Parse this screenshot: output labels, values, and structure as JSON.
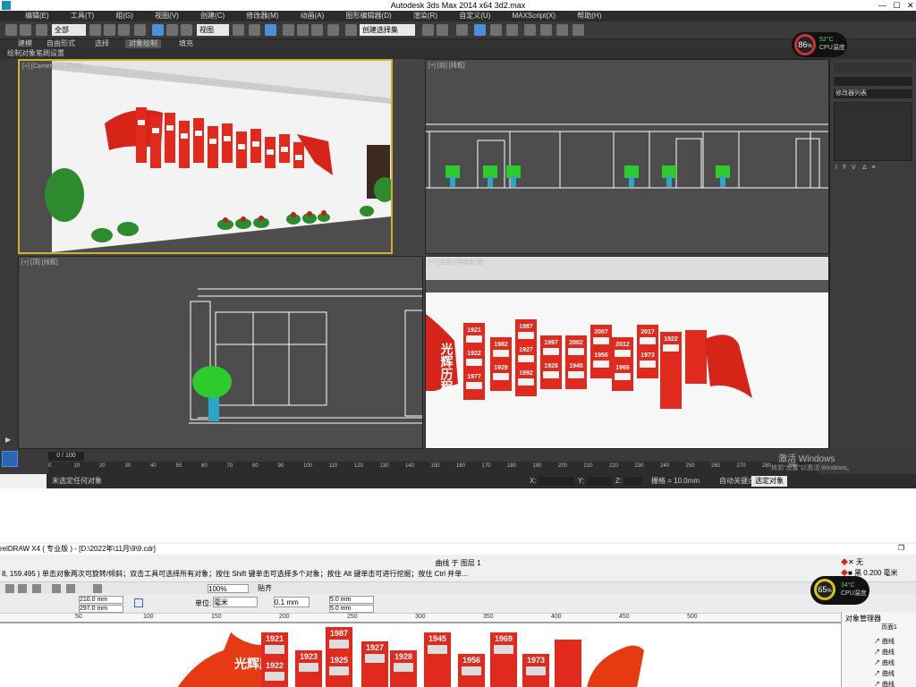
{
  "max_window": {
    "title": "Autodesk 3ds Max  2014 x64      3d2.max",
    "menus": [
      "编辑(E)",
      "工具(T)",
      "组(G)",
      "视图(V)",
      "创建(C)",
      "修改器(M)",
      "动画(A)",
      "图形编辑器(D)",
      "渲染(R)",
      "自定义(U)",
      "MAXScript(X)",
      "帮助(H)"
    ],
    "toolbar": {
      "filter_value": "全部",
      "view_value": "视图",
      "selection_set": "创建选择集"
    },
    "ribbon_tabs": [
      "建模",
      "自由形式",
      "选择",
      "对象绘制",
      "填充"
    ],
    "ribbon_sub": [
      "绘制对象",
      "笔刷设置"
    ],
    "viewports": {
      "camera": "[+] [Camera01] [真实]",
      "front": "[+] [前] [线框]",
      "top": "[+] [顶] [线框]",
      "perspective": "[+] [透视] [明暗处理]"
    },
    "cpu": {
      "percent": "86",
      "unit": "%",
      "temp": "52°C",
      "temp_label": "CPU温度"
    },
    "command_panel": {
      "modifier_list": "修改器列表"
    },
    "timeline": {
      "frame": "0 / 100",
      "ticks": [
        "0",
        "10",
        "20",
        "30",
        "40",
        "50",
        "60",
        "70",
        "80",
        "90",
        "100",
        "110",
        "120",
        "130",
        "140",
        "150",
        "160",
        "170",
        "180",
        "190",
        "200",
        "210",
        "220",
        "230",
        "240",
        "250",
        "260",
        "270",
        "280",
        "290"
      ]
    },
    "status": {
      "message": "未选定任何对象",
      "x_label": "X:",
      "y_label": "Y:",
      "z_label": "Z:",
      "grid": "栅格 = 10.0mm",
      "autokey": "自动关键点",
      "selected_objects": "选定对象"
    },
    "activate_windows": {
      "line1": "激活 Windows",
      "line2": "转到\"设置\"以激活 Windows。"
    }
  },
  "corel_window": {
    "title": "relDRAW X4 ( 专业版 ) - [D:\\2022年\\11月\\9\\9.cdr]",
    "layer_info": "曲线 于 图层 1",
    "status_hint": "8, 159.495 )      单击对象两次可旋转/倾斜；双击工具可选择所有对象；按住 Shift 键单击可选择多个对象；按住 Alt 键单击可进行挖掘；按住 Ctrl 并单...",
    "fill_none": "无",
    "outline_black": "黑",
    "outline_width": "0.200 毫米",
    "zoom": "100%",
    "snap": "贴齐",
    "width": "210.0 mm",
    "height": "297.0 mm",
    "unit_label": "单位:",
    "unit_value": "毫米",
    "nudge": "0.1 mm",
    "dup_x": "5.0 mm",
    "dup_y": "5.0 mm",
    "cpu": {
      "percent": "65",
      "unit": "%",
      "temp": "34°C",
      "temp_label": "CPU温度"
    },
    "ruler": [
      "50",
      "100",
      "150",
      "200",
      "250",
      "300",
      "350",
      "400",
      "450",
      "500"
    ],
    "object_manager": {
      "title": "对象管理器",
      "page_label": "页面1",
      "items": [
        "曲线",
        "曲线",
        "曲线",
        "曲线",
        "曲线"
      ]
    }
  },
  "panel_years_persp": [
    "1921",
    "1922",
    "1977",
    "1982",
    "1929",
    "1987",
    "1927",
    "1992",
    "1997",
    "1928",
    "2002",
    "1945",
    "2007",
    "1956",
    "2012",
    "1965",
    "2017",
    "1973",
    "1922"
  ],
  "panel_years_corel": [
    "1921",
    "1922",
    "1923",
    "1987",
    "1925",
    "1927",
    "1928",
    "1945",
    "1956",
    "1969",
    "1973"
  ],
  "slogan": "光辉历程",
  "colors": {
    "party_red": "#e02a1d",
    "max_bg": "#444444",
    "viewport_active": "#d0b030",
    "corel_bg": "#f0f0f0"
  }
}
